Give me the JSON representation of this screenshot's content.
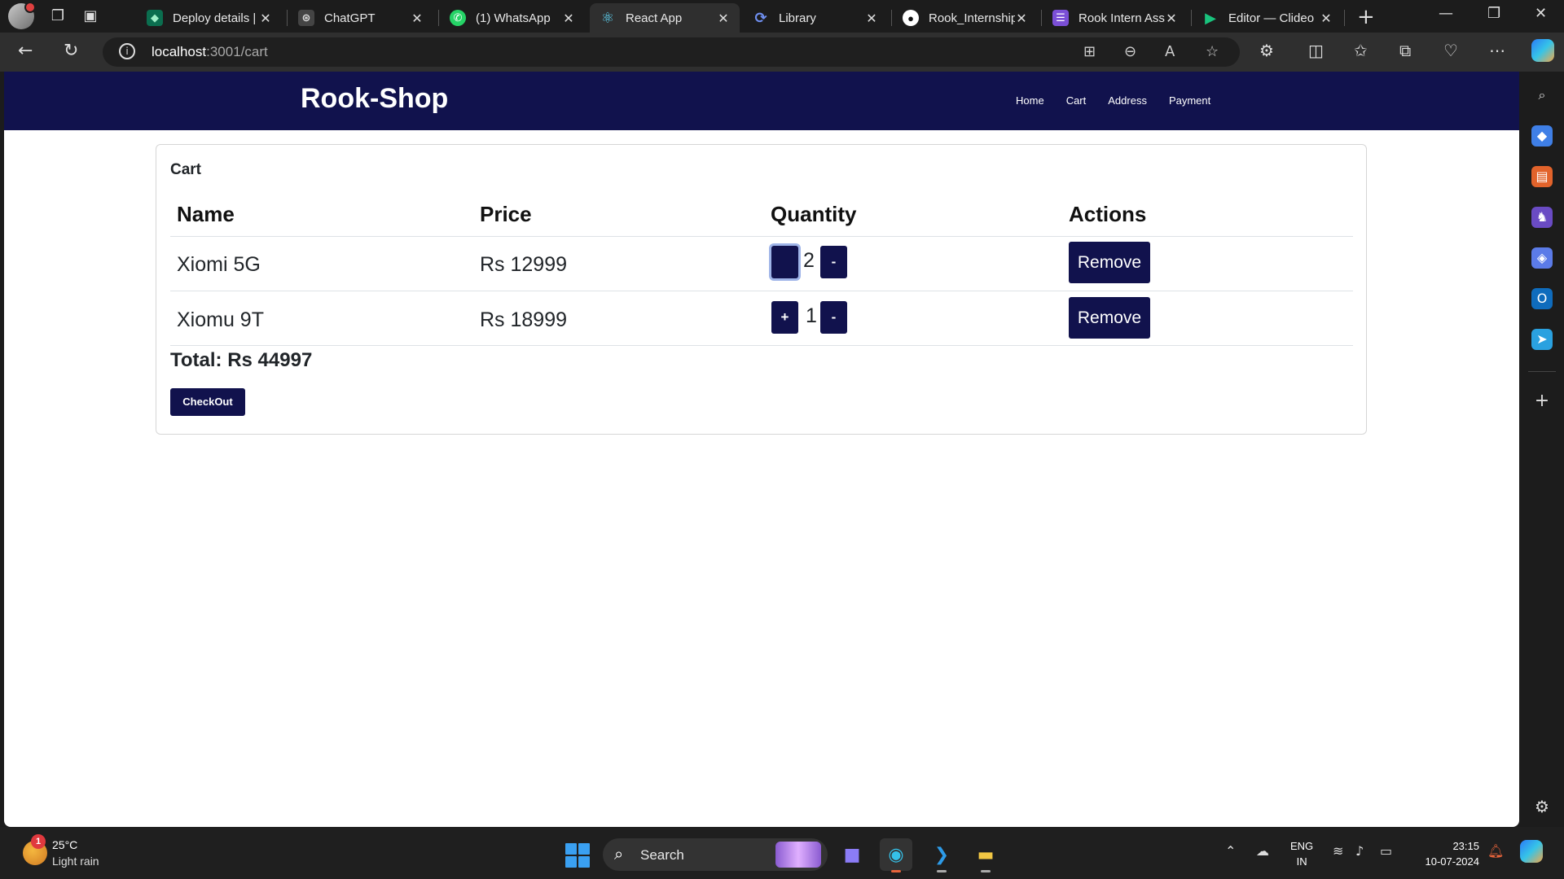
{
  "browser": {
    "tabs": [
      {
        "label": "Deploy details |",
        "fav_color": "#0b6e4f",
        "fav_glyph": "◆"
      },
      {
        "label": "ChatGPT",
        "fav_color": "#444444",
        "fav_glyph": "⊛"
      },
      {
        "label": "(1) WhatsApp",
        "fav_color": "#25d366",
        "fav_glyph": "✆"
      },
      {
        "label": "React App",
        "fav_color": "#2f2f2f",
        "fav_glyph": "⚛",
        "active": true
      },
      {
        "label": "Library",
        "fav_color": "#3b6ee0",
        "fav_glyph": "⟳"
      },
      {
        "label": "Rook_Internship",
        "fav_color": "#ffffff",
        "fav_glyph": "●"
      },
      {
        "label": "Rook Intern Ass",
        "fav_color": "#7b4fd6",
        "fav_glyph": "☰"
      },
      {
        "label": "Editor — Clideo",
        "fav_color": "#19c37d",
        "fav_glyph": "▶"
      }
    ],
    "url_host": "localhost",
    "url_path": ":3001/cart"
  },
  "site": {
    "brand": "Rook-Shop",
    "nav": [
      "Home",
      "Cart",
      "Address",
      "Payment"
    ]
  },
  "cart": {
    "title": "Cart",
    "columns": [
      "Name",
      "Price",
      "Quantity",
      "Actions"
    ],
    "items": [
      {
        "name": "Xiomi 5G",
        "price": "Rs 12999",
        "qty": "2",
        "plus": "",
        "minus": "-",
        "remove": "Remove"
      },
      {
        "name": "Xiomu 9T",
        "price": "Rs 18999",
        "qty": "1",
        "plus": "+",
        "minus": "-",
        "remove": "Remove"
      }
    ],
    "total": "Total: Rs 44997",
    "checkout": "CheckOut"
  },
  "taskbar": {
    "weather_temp": "25°C",
    "weather_desc": "Light rain",
    "weather_badge": "1",
    "search_placeholder": "Search",
    "lang_line1": "ENG",
    "lang_line2": "IN",
    "time": "23:15",
    "date": "10-07-2024"
  },
  "colors": {
    "brand_navy": "#11124d",
    "chrome_dark": "#1c1c1c",
    "toolbar": "#2f2f2f"
  }
}
